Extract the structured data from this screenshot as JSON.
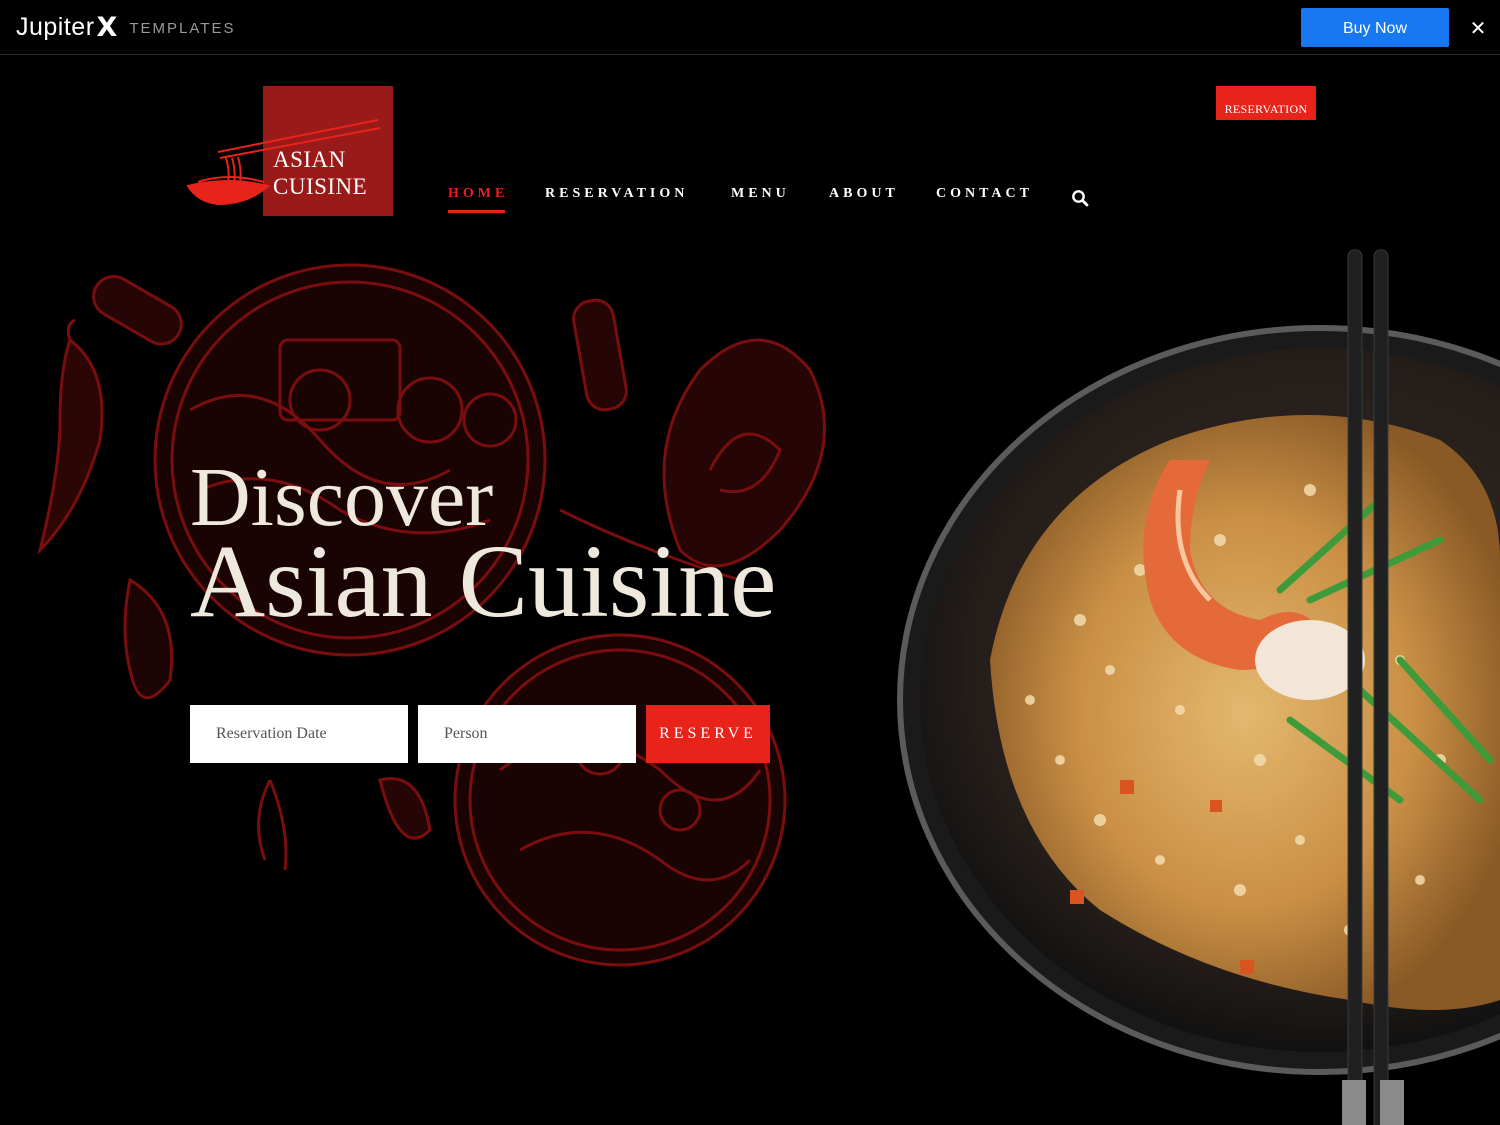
{
  "topbar": {
    "brand_name": "Jupiter",
    "brand_mark": "X",
    "brand_tag": "TEMPLATES",
    "buy_label": "Buy Now",
    "close_icon": "close-icon",
    "buy_color": "#1778f2"
  },
  "logo": {
    "line1": "ASIAN",
    "line2": "CUISINE",
    "box_color": "#9a1a1a"
  },
  "header": {
    "reserve_label": "RESERVATION",
    "accent_color": "#e8231a"
  },
  "nav": {
    "items": [
      {
        "label": "HOME",
        "active": true
      },
      {
        "label": "RESERVATION",
        "active": false
      },
      {
        "label": "MENU",
        "active": false
      },
      {
        "label": "ABOUT",
        "active": false
      },
      {
        "label": "CONTACT",
        "active": false
      }
    ],
    "search_icon": "search-icon"
  },
  "hero": {
    "line1": "Discover",
    "line2": "Asian Cuisine"
  },
  "form": {
    "date_placeholder": "Reservation Date",
    "person_placeholder": "Person",
    "submit_label": "RESERVE"
  }
}
